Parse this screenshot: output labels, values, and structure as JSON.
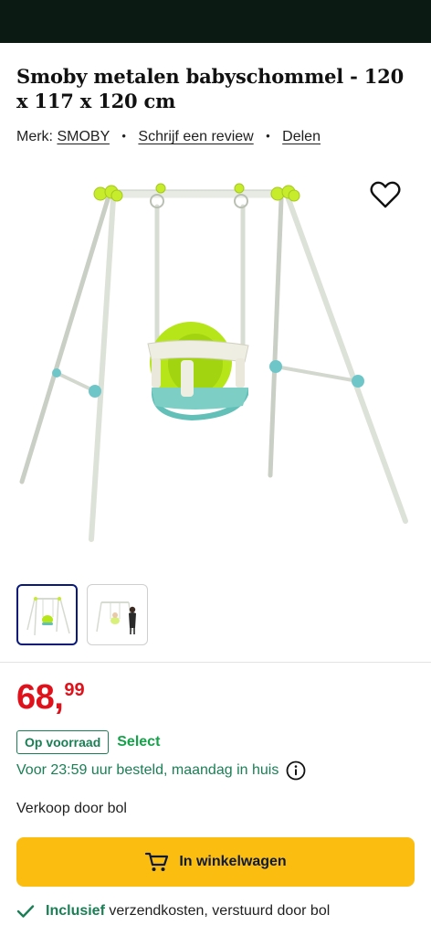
{
  "product": {
    "title": "Smoby metalen babyschommel - 120 x 117 x 120 cm",
    "brand_label": "Merk:",
    "brand": "SMOBY",
    "review_link": "Schrijf een review",
    "share_link": "Delen",
    "separator": "•"
  },
  "gallery": {
    "thumbnails": [
      "swing-photo",
      "swing-with-child-photo"
    ],
    "active_index": 0
  },
  "price": {
    "whole": "68,",
    "fraction": "99"
  },
  "availability": {
    "stock_badge": "Op voorraad",
    "select_label": "Select",
    "delivery_text": "Voor 23:59 uur besteld, maandag in huis"
  },
  "seller": {
    "text": "Verkoop door bol"
  },
  "cart": {
    "button_label": "In winkelwagen"
  },
  "usps": [
    {
      "bold": "Inclusief",
      "text": " verzendkosten, verstuurd door bol"
    }
  ],
  "icons": {
    "favorite": "heart-outline-icon",
    "info": "info-circle-icon",
    "cart": "cart-icon",
    "check": "checkmark-icon"
  },
  "colors": {
    "price": "#e0111a",
    "accent_green": "#1a7f55",
    "select_green": "#15a24a",
    "cart_button": "#fcbd11",
    "top_bar": "#0b1a12"
  }
}
